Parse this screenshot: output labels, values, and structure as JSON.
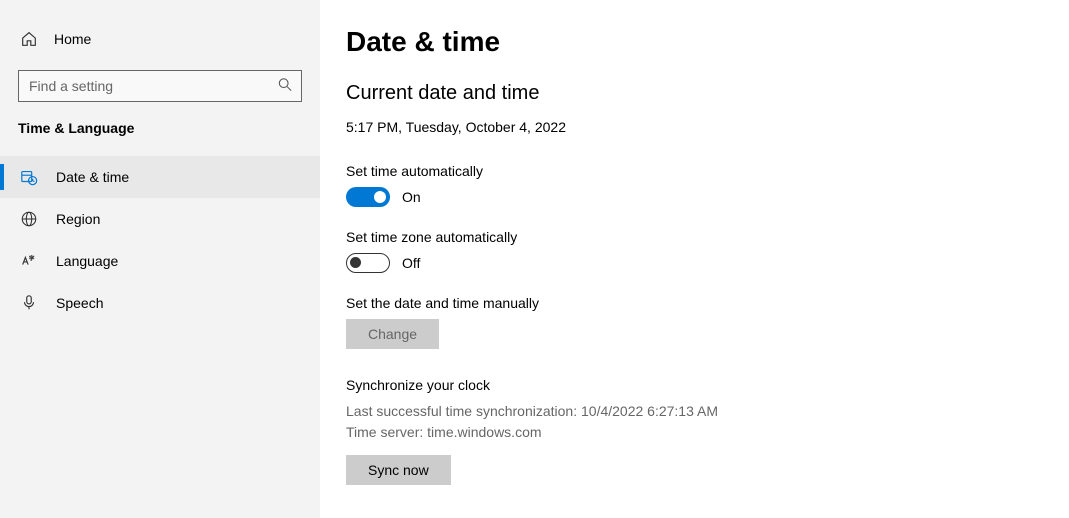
{
  "sidebar": {
    "home_label": "Home",
    "search_placeholder": "Find a setting",
    "section_header": "Time & Language",
    "items": [
      {
        "label": "Date & time"
      },
      {
        "label": "Region"
      },
      {
        "label": "Language"
      },
      {
        "label": "Speech"
      }
    ]
  },
  "content": {
    "title": "Date & time",
    "subheading": "Current date and time",
    "datetime": "5:17 PM, Tuesday, October 4, 2022",
    "set_time_auto_label": "Set time automatically",
    "set_time_auto_state": "On",
    "set_tz_auto_label": "Set time zone automatically",
    "set_tz_auto_state": "Off",
    "manual_label": "Set the date and time manually",
    "change_btn": "Change",
    "sync_heading": "Synchronize your clock",
    "sync_last": "Last successful time synchronization: 10/4/2022 6:27:13 AM",
    "sync_server": "Time server: time.windows.com",
    "sync_btn": "Sync now"
  }
}
